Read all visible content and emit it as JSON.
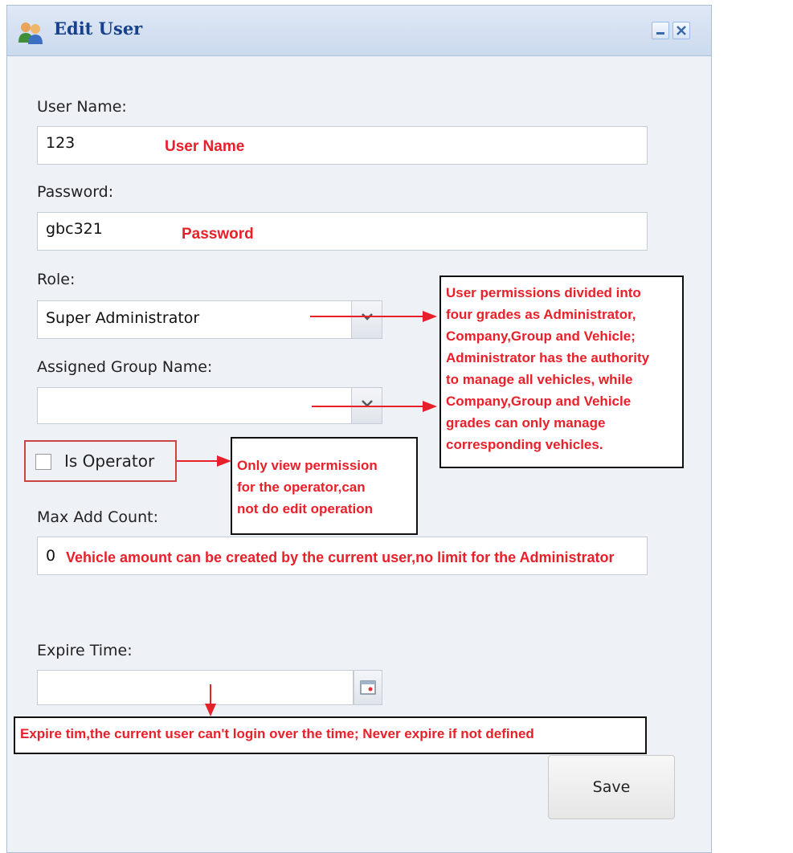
{
  "window": {
    "title": "Edit User",
    "icon": "users-icon"
  },
  "form": {
    "user_name": {
      "label": "User Name:",
      "value": "123"
    },
    "password": {
      "label": "Password:",
      "value": "gbc321"
    },
    "role": {
      "label": "Role:",
      "value": "Super Administrator"
    },
    "group": {
      "label": "Assigned Group Name:",
      "value": ""
    },
    "is_operator": {
      "label": "Is Operator",
      "checked": false
    },
    "max_add_count": {
      "label": "Max Add Count:",
      "value": "0"
    },
    "expire_time": {
      "label": "Expire Time:",
      "value": ""
    },
    "save_label": "Save"
  },
  "annotations": {
    "user_name": "User Name",
    "password": "Password",
    "role_lines": [
      "User permissions divided into",
      "four grades as Administrator,",
      "Company,Group and Vehicle;",
      "Administrator has the authority",
      "to manage all vehicles, while",
      "Company,Group and Vehicle",
      "grades can only manage",
      "corresponding vehicles."
    ],
    "operator_lines": [
      "Only view permission",
      "for the operator,can",
      "not do edit operation"
    ],
    "max_add": "Vehicle amount can be created by the current user,no limit for the Administrator",
    "expire": "Expire tim,the current user can't login over the time; Never expire if not defined"
  },
  "colors": {
    "annotation": "#e8202a",
    "title": "#15428b"
  }
}
